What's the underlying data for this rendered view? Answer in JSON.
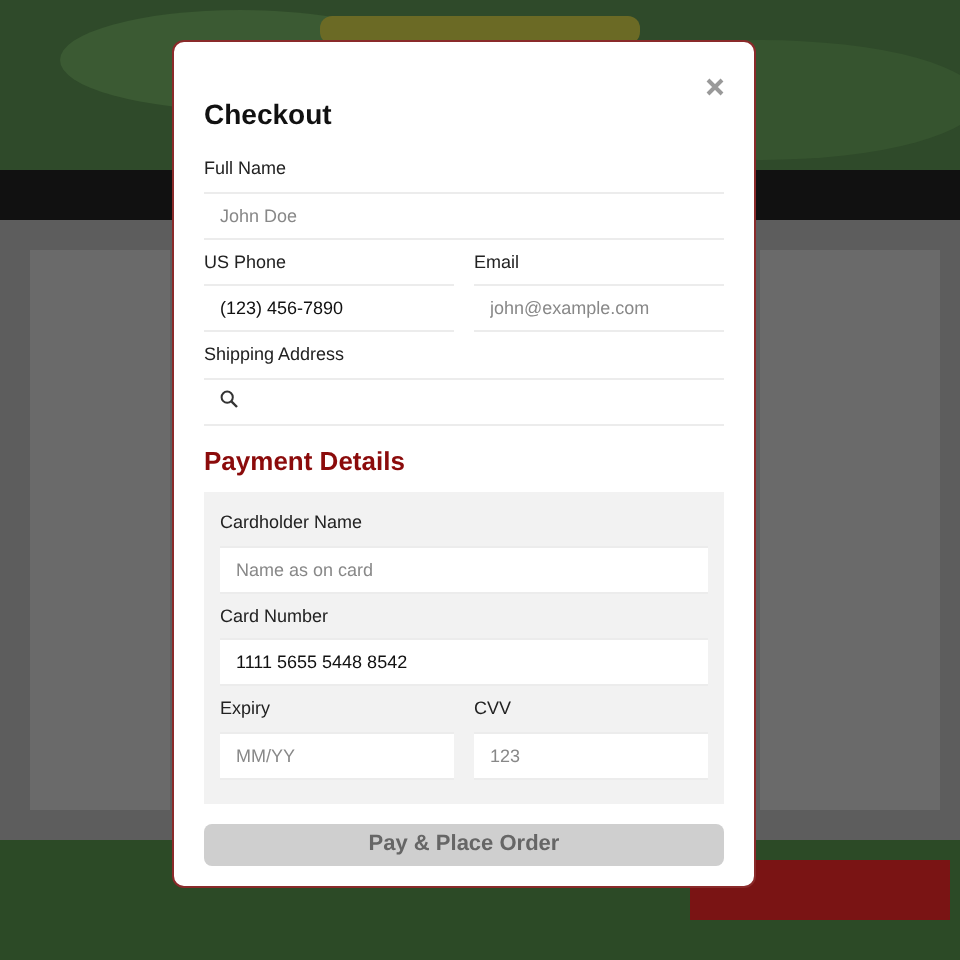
{
  "dialog": {
    "title": "Checkout",
    "contact_rows": [
      [
        {
          "label": "Full Name",
          "placeholder": "John Doe"
        }
      ],
      [
        {
          "label": "US Phone",
          "value": "(123) 456-7890"
        },
        {
          "label": "Email",
          "placeholder": "john@example.com"
        }
      ],
      [
        {
          "label": "Shipping Address",
          "kind": "search"
        }
      ]
    ],
    "payment": {
      "heading": "Payment Details",
      "rows": [
        [
          {
            "label": "Cardholder Name",
            "placeholder": "Name as on card"
          }
        ],
        [
          {
            "label": "Card Number",
            "value": "1111 5655 5448 8542"
          }
        ],
        [
          {
            "label": "Expiry",
            "placeholder": "MM/YY"
          },
          {
            "label": "CVV",
            "placeholder": "123"
          }
        ]
      ]
    },
    "submit": {
      "label": "Pay & Place Order",
      "disabled": true
    }
  }
}
